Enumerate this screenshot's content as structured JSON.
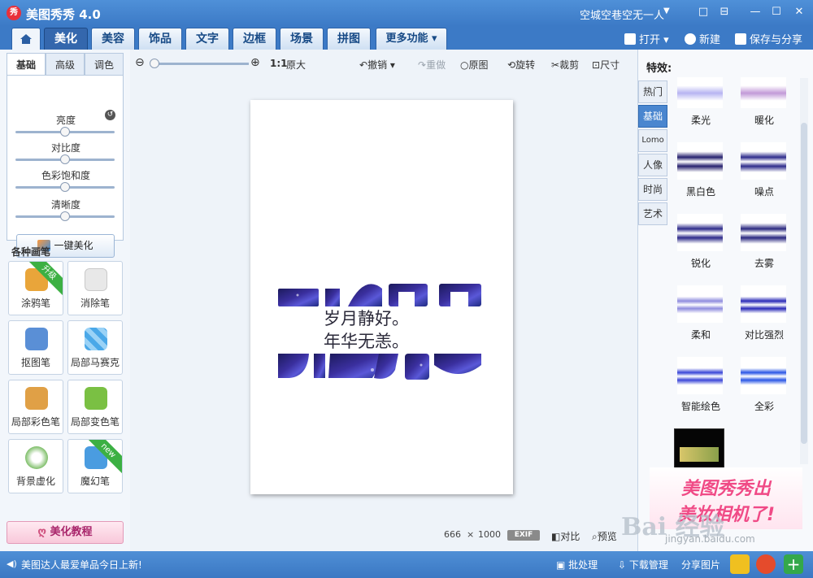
{
  "app": {
    "logo_text": "秀",
    "title": "美图秀秀 4.0",
    "user": "空城空巷空无一人"
  },
  "window": {
    "skin_icon": "□",
    "restore_icon": "⊟",
    "min_icon": "—",
    "max_icon": "☐",
    "close_icon": "✕"
  },
  "tabs": [
    "美化",
    "美容",
    "饰品",
    "文字",
    "边框",
    "场景",
    "拼图"
  ],
  "more_tab": "更多功能 ▾",
  "file_actions": {
    "open": "打开",
    "new": "新建",
    "save_share": "保存与分享"
  },
  "left": {
    "subtabs": [
      "基础",
      "高级",
      "调色"
    ],
    "adjustments": [
      {
        "label": "亮度",
        "value": 0.5
      },
      {
        "label": "对比度",
        "value": 0.5
      },
      {
        "label": "色彩饱和度",
        "value": 0.5
      },
      {
        "label": "清晰度",
        "value": 0.5
      }
    ],
    "reset_glyph": "↺",
    "one_key_button": "一键美化",
    "brushes_title": "各种画笔",
    "brushes": [
      {
        "label": "涂鸦笔",
        "badge": "升级",
        "icon": "pen-icon",
        "color": "#e9a53a"
      },
      {
        "label": "消除笔",
        "badge": "",
        "icon": "eraser-icon",
        "color": "#e8e8e8"
      },
      {
        "label": "抠图笔",
        "badge": "",
        "icon": "cutout-pen-icon",
        "color": "#5a8fd6"
      },
      {
        "label": "局部马赛克",
        "badge": "",
        "icon": "mosaic-icon",
        "color": "#4aa8e8"
      },
      {
        "label": "局部彩色笔",
        "badge": "",
        "icon": "color-brush-icon",
        "color": "#e0a046"
      },
      {
        "label": "局部变色笔",
        "badge": "",
        "icon": "paint-bucket-icon",
        "color": "#7ac043"
      },
      {
        "label": "背景虚化",
        "badge": "",
        "icon": "blur-bg-icon",
        "color": "#7fbf6a"
      },
      {
        "label": "魔幻笔",
        "badge": "new",
        "icon": "magic-wand-icon",
        "color": "#4a9ce0"
      }
    ],
    "tutorial": "美化教程"
  },
  "toolbar": {
    "zoom_level": 0,
    "actual_size_ratio": "1:1",
    "actual_size": "原大",
    "undo": "撤销",
    "redo": "重做",
    "original": "原图",
    "rotate": "旋转",
    "crop": "裁剪",
    "resize": "尺寸"
  },
  "canvas": {
    "line1": "岁月静好。",
    "line2": "年华无恙。"
  },
  "status": {
    "width": "666",
    "times": "×",
    "height": "1000",
    "exif": "EXIF",
    "compare": "对比",
    "preview": "预览"
  },
  "right": {
    "title": "特效:",
    "categories": [
      "热门",
      "基础",
      "Lomo",
      "人像",
      "时尚",
      "艺术"
    ],
    "active_category": "基础",
    "effects": [
      "柔光",
      "暖化",
      "黑白色",
      "噪点",
      "锐化",
      "去雾",
      "柔和",
      "对比强烈",
      "智能绘色",
      "全彩"
    ],
    "ad_line1": "美图秀秀出",
    "ad_line2": "美妆相机了!"
  },
  "watermark": {
    "main": "Bai 经验",
    "sub": "jingyan.baidu.com"
  },
  "bottom": {
    "news": "美图达人最爱单品今日上新!",
    "batch": "批处理",
    "download": "下载管理",
    "share": "分享图片"
  },
  "colors": {
    "title_blue": "#3c7ac6",
    "active_tab": "#3467ad",
    "galaxy_dark": "#1c1a5c",
    "galaxy_light": "#5a58d8"
  }
}
